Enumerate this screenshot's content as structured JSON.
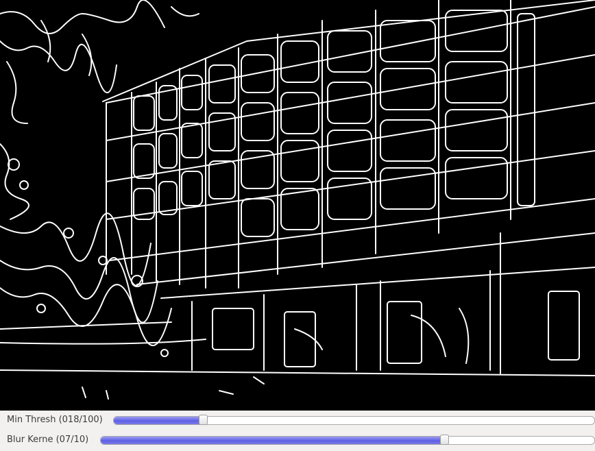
{
  "window": {
    "image_name": "canny-edge-output-image"
  },
  "trackbars": [
    {
      "label": "Min Thresh (018/100)",
      "value": 18,
      "max": 100,
      "fraction": 0.18
    },
    {
      "label": "Blur Kerne (07/10)",
      "value": 7,
      "max": 10,
      "fraction": 0.7
    }
  ],
  "colors": {
    "slider_fill": "#6a6ae6",
    "canvas_background": "#000000",
    "edges": "#ffffff",
    "panel_background": "#f2f1f0"
  }
}
